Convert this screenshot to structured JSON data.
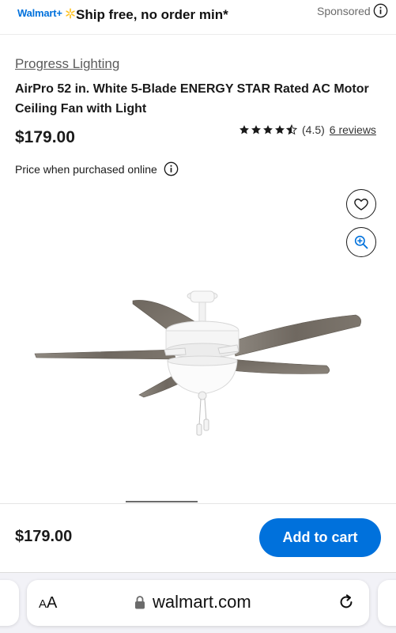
{
  "banner": {
    "logo_text": "Walmart+",
    "headline": "Ship free, no order min*",
    "sponsored_label": "Sponsored"
  },
  "product": {
    "brand": "Progress Lighting",
    "title": "AirPro 52 in. White 5-Blade ENERGY STAR Rated AC Motor Ceiling Fan with Light",
    "price": "$179.00",
    "rating_value": "(4.5)",
    "rating_stars": 4.5,
    "reviews_label": "6 reviews",
    "online_note": "Price when purchased online",
    "image_icon": "ceiling-fan-image"
  },
  "sticky_bar": {
    "price": "$179.00",
    "add_to_cart_label": "Add to cart"
  },
  "browser": {
    "aa_big": "A",
    "aa_small": "A",
    "url": "walmart.com"
  },
  "colors": {
    "brand_blue": "#0071dc",
    "spark_yellow": "#ffc220",
    "text_dark": "#1a1a1a"
  }
}
